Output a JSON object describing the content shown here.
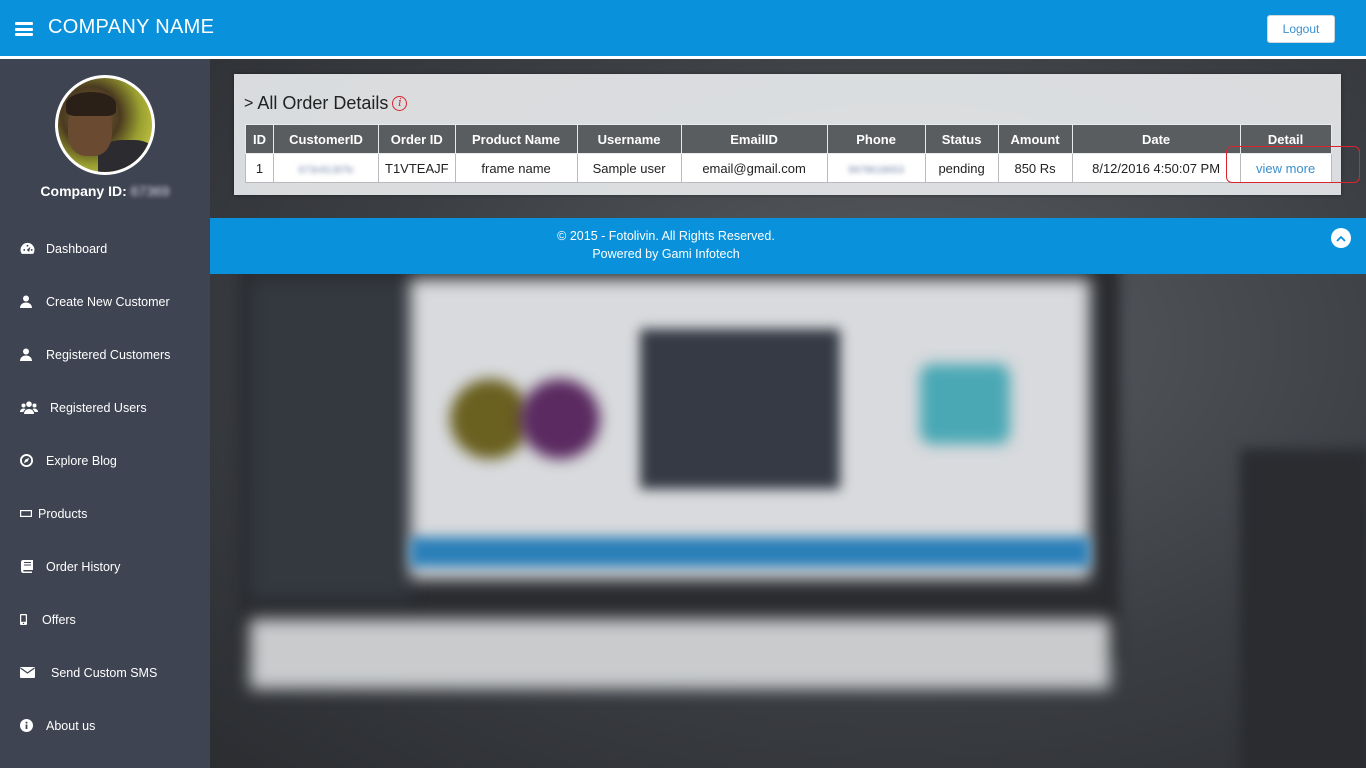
{
  "header": {
    "brand": "COMPANY NAME",
    "logout_label": "Logout"
  },
  "sidebar": {
    "company_id_label": "Company ID: ",
    "company_id_value": "67369",
    "items": [
      {
        "label": "Dashboard",
        "icon": "dashboard-icon"
      },
      {
        "label": "Create New Customer",
        "icon": "user-icon"
      },
      {
        "label": "Registered Customers",
        "icon": "user-icon"
      },
      {
        "label": "Registered Users",
        "icon": "users-icon"
      },
      {
        "label": "Explore Blog",
        "icon": "compass-icon"
      },
      {
        "label": "Products",
        "icon": "rectangle-icon"
      },
      {
        "label": "Order History",
        "icon": "book-icon"
      },
      {
        "label": "Offers",
        "icon": "mobile-icon"
      },
      {
        "label": "Send Custom SMS",
        "icon": "envelope-icon"
      },
      {
        "label": "About us",
        "icon": "info-icon"
      }
    ]
  },
  "main": {
    "title": "All Order Details",
    "columns": [
      "ID",
      "CustomerID",
      "Order ID",
      "Product Name",
      "Username",
      "EmailID",
      "Phone",
      "Status",
      "Amount",
      "Date",
      "Detail"
    ],
    "rows": [
      {
        "id": "1",
        "customer_id": "673n9130Te",
        "order_id": "T1VTEAJF",
        "product_name": "frame name",
        "username": "Sample user",
        "email": "email@gmail.com",
        "phone": "9978618653",
        "status": "pending",
        "amount": "850 Rs",
        "date": "8/12/2016 4:50:07 PM",
        "detail_link": "view more"
      }
    ]
  },
  "footer": {
    "line1": "© 2015 - Fotolivin. All Rights Reserved.",
    "line2": "Powered by Gami Infotech"
  },
  "colors": {
    "header_blue": "#0992db",
    "sidebar_bg": "#3e4451",
    "highlight_red": "#d9242e"
  }
}
